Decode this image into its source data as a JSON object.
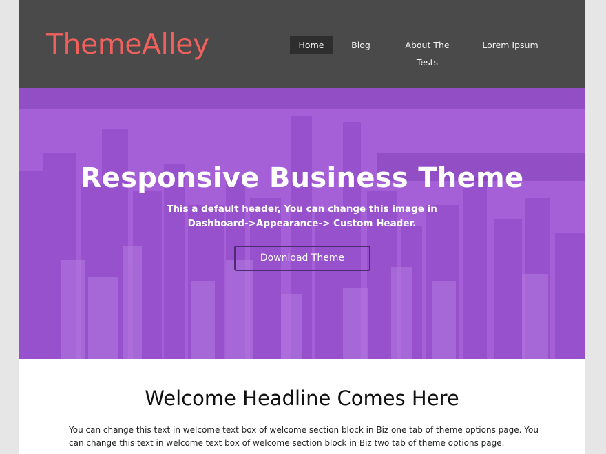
{
  "header": {
    "logo": "ThemeAlley",
    "nav": [
      {
        "label": "Home",
        "active": true
      },
      {
        "label": "Blog",
        "active": false
      },
      {
        "label": "About The Tests",
        "active": false
      },
      {
        "label": "Lorem Ipsum",
        "active": false
      }
    ]
  },
  "hero": {
    "title": "Responsive Business Theme",
    "subtitle_line1": "This a default header, You can change this image in",
    "subtitle_line2": "Dashboard->Appearance-> Custom Header.",
    "button_label": "Download Theme",
    "overlay_color": "#a560d8"
  },
  "welcome": {
    "title": "Welcome Headline Comes Here",
    "text": "You can change this text in welcome text box of welcome section block in Biz one tab of theme options page. You can change this text in welcome text box of welcome section block in Biz two tab of theme options page."
  },
  "colors": {
    "header_bg": "#4a4a4a",
    "logo": "#f0605d",
    "nav_active_bg": "#2e2e2e",
    "page_bg": "#e6e6e6"
  }
}
